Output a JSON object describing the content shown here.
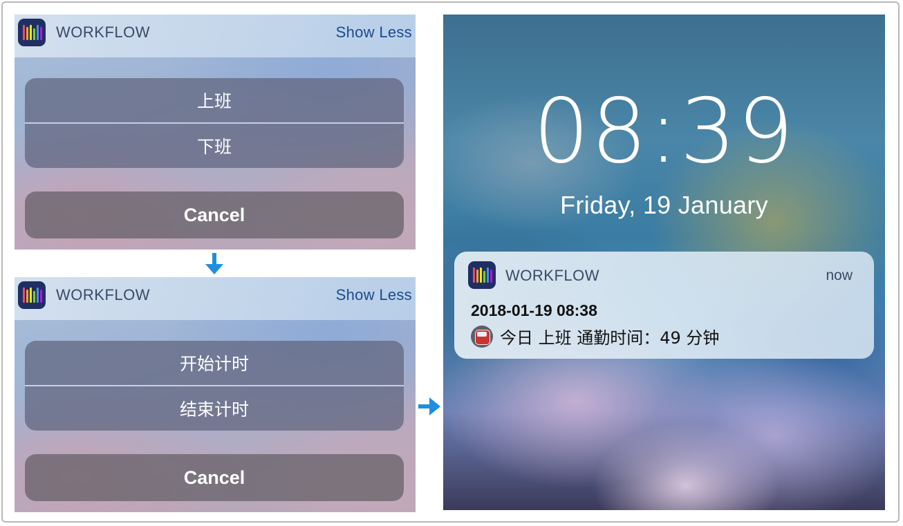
{
  "widget_panels": [
    {
      "app_name": "WORKFLOW",
      "show_less_label": "Show Less",
      "buttons": [
        "上班",
        "下班"
      ],
      "cancel_label": "Cancel"
    },
    {
      "app_name": "WORKFLOW",
      "show_less_label": "Show Less",
      "buttons": [
        "开始计时",
        "结束计时"
      ],
      "cancel_label": "Cancel"
    }
  ],
  "lock_screen": {
    "time": "08:39",
    "date": "Friday, 19 January",
    "notification": {
      "app_name": "WORKFLOW",
      "time": "now",
      "title": "2018-01-19 08:38",
      "body": "今日 上班 通勤时间：49 分钟",
      "body_icon": "metro-train-icon"
    }
  },
  "icons": {
    "app_icon": "workflow-app-icon",
    "arrow_down": "arrow-down-icon",
    "arrow_right": "arrow-right-icon"
  },
  "colors": {
    "accent_link": "#1b4a8e",
    "arrow": "#1e8fe0",
    "app_icon_bg": "#1f2f63"
  }
}
